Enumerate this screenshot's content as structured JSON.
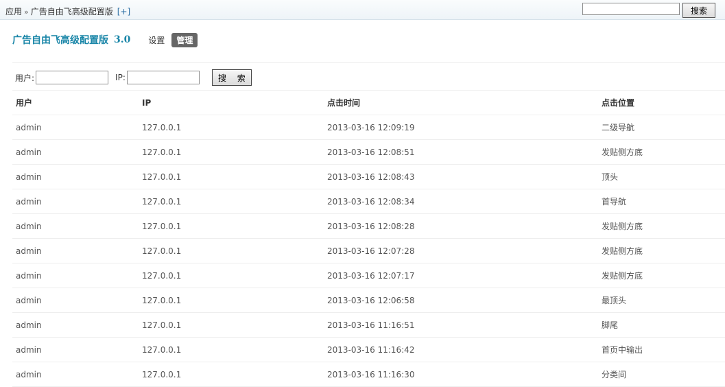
{
  "breadcrumb": {
    "root": "应用",
    "separator": "»",
    "current": "广告自由飞高级配置版",
    "add": "[+]"
  },
  "top_search": {
    "value": "",
    "button": "搜索"
  },
  "header": {
    "title": "广告自由飞高级配置版",
    "version": "3.0",
    "tabs": [
      {
        "label": "设置",
        "active": false
      },
      {
        "label": "管理",
        "active": true
      }
    ]
  },
  "filter": {
    "user_label": "用户:",
    "user_value": "",
    "ip_label": "IP:",
    "ip_value": "",
    "search_button": "搜 索"
  },
  "table": {
    "columns": [
      "用户",
      "IP",
      "点击时间",
      "点击位置"
    ],
    "rows": [
      [
        "admin",
        "127.0.0.1",
        "2013-03-16 12:09:19",
        "二级导航"
      ],
      [
        "admin",
        "127.0.0.1",
        "2013-03-16 12:08:51",
        "发贴侧方底"
      ],
      [
        "admin",
        "127.0.0.1",
        "2013-03-16 12:08:43",
        "顶头"
      ],
      [
        "admin",
        "127.0.0.1",
        "2013-03-16 12:08:34",
        "首导航"
      ],
      [
        "admin",
        "127.0.0.1",
        "2013-03-16 12:08:28",
        "发贴侧方底"
      ],
      [
        "admin",
        "127.0.0.1",
        "2013-03-16 12:07:28",
        "发贴侧方底"
      ],
      [
        "admin",
        "127.0.0.1",
        "2013-03-16 12:07:17",
        "发贴侧方底"
      ],
      [
        "admin",
        "127.0.0.1",
        "2013-03-16 12:06:58",
        "最顶头"
      ],
      [
        "admin",
        "127.0.0.1",
        "2013-03-16 11:16:51",
        "脚尾"
      ],
      [
        "admin",
        "127.0.0.1",
        "2013-03-16 11:16:42",
        "首页中输出"
      ],
      [
        "admin",
        "127.0.0.1",
        "2013-03-16 11:16:30",
        "分类间"
      ]
    ]
  },
  "colors": {
    "title": "#1a86a8",
    "active_tab_bg": "#666666",
    "topbar_bg": "#eef4f8",
    "row_border": "#eeeeee"
  }
}
